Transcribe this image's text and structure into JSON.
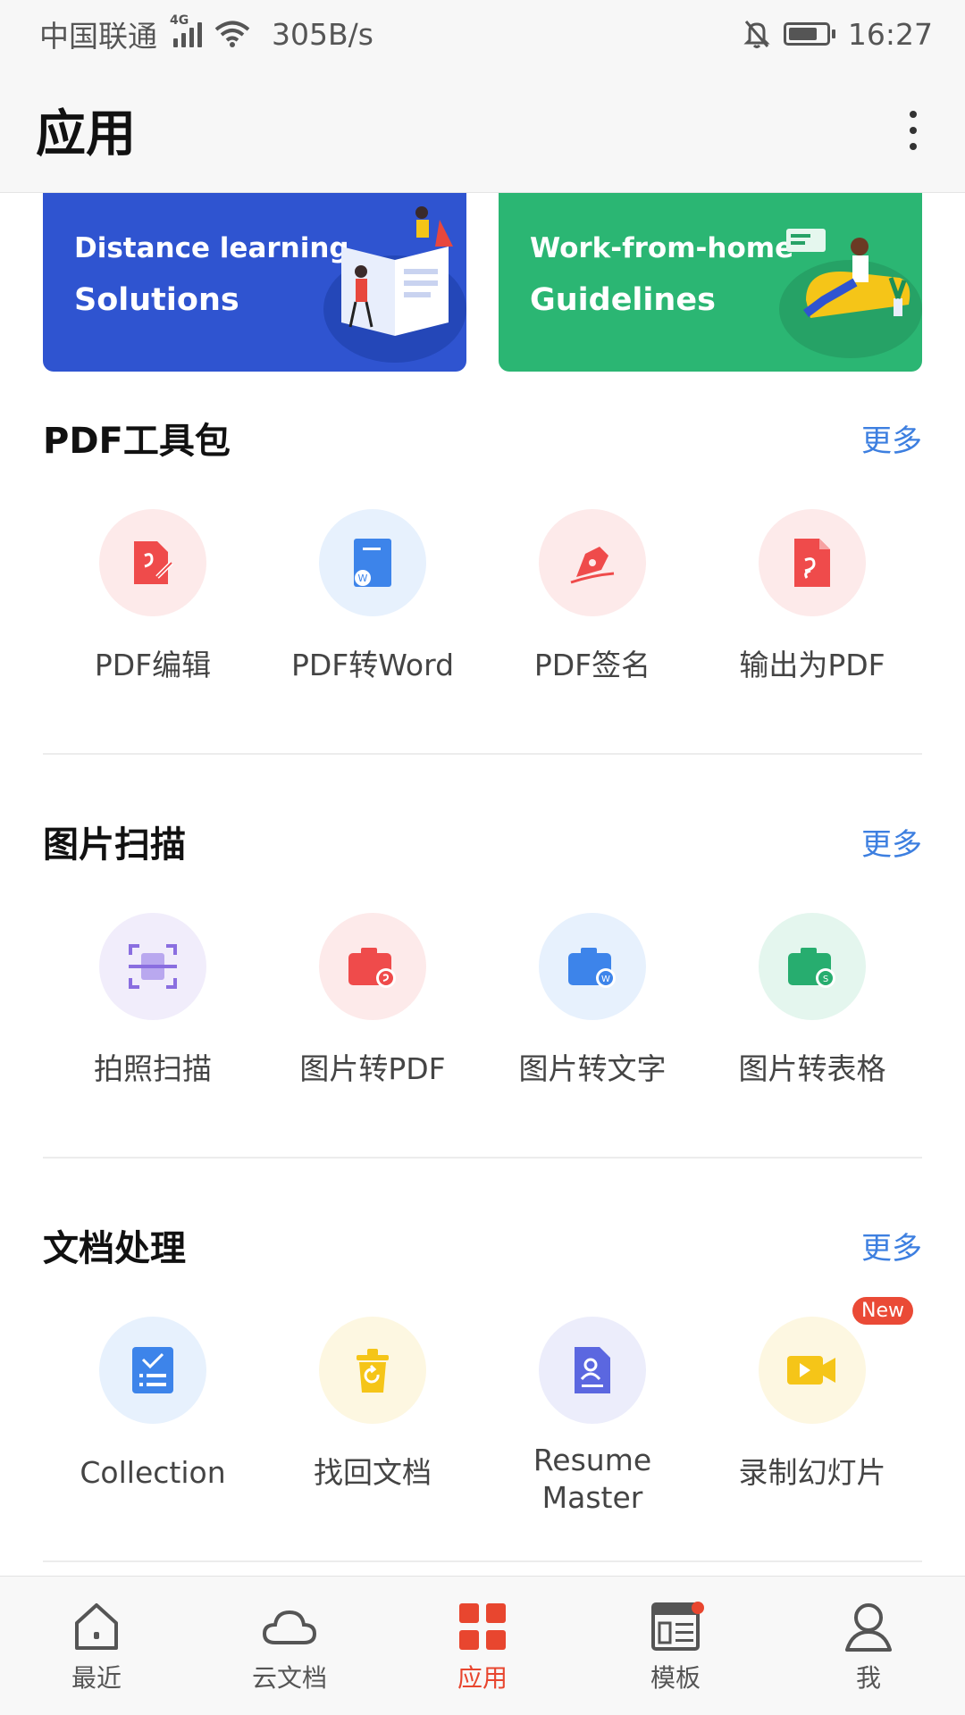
{
  "status_bar": {
    "carrier": "中国联通",
    "network_type": "4G",
    "speed": "305B/s",
    "time": "16:27",
    "icons": [
      "signal-icon",
      "wifi-icon",
      "bell-off-icon",
      "battery-icon"
    ]
  },
  "header": {
    "title": "应用",
    "menu_icon": "more-vertical-icon"
  },
  "banners": [
    {
      "line1": "Distance learning",
      "line2": "Solutions",
      "color": "#2f54d0"
    },
    {
      "line1": "Work-from-home",
      "line2": "Guidelines",
      "color": "#2bb673"
    }
  ],
  "sections": [
    {
      "title": "PDF工具包",
      "more": "更多",
      "tools": [
        {
          "label": "PDF编辑",
          "icon": "pdf-edit-icon",
          "bg": "#fdeaea",
          "color": "#ef4b4b"
        },
        {
          "label": "PDF转Word",
          "icon": "pdf-to-word-icon",
          "bg": "#e7f1fd",
          "color": "#3d84ea"
        },
        {
          "label": "PDF签名",
          "icon": "pen-nib-icon",
          "bg": "#fdeaea",
          "color": "#ef4b4b"
        },
        {
          "label": "输出为PDF",
          "icon": "export-pdf-icon",
          "bg": "#fdeaea",
          "color": "#ef4b4b"
        }
      ]
    },
    {
      "title": "图片扫描",
      "more": "更多",
      "tools": [
        {
          "label": "拍照扫描",
          "icon": "scan-icon",
          "bg": "#f1edfb",
          "color": "#8a6ee0"
        },
        {
          "label": "图片转PDF",
          "icon": "camera-pdf-icon",
          "bg": "#fdeaea",
          "color": "#ef4b4b"
        },
        {
          "label": "图片转文字",
          "icon": "camera-word-icon",
          "bg": "#e7f1fd",
          "color": "#3d84ea"
        },
        {
          "label": "图片转表格",
          "icon": "camera-sheet-icon",
          "bg": "#e4f6ee",
          "color": "#27ad6f"
        }
      ]
    },
    {
      "title": "文档处理",
      "more": "更多",
      "tools": [
        {
          "label": "Collection",
          "icon": "checklist-icon",
          "bg": "#e7f1fd",
          "color": "#3d84ea"
        },
        {
          "label": "找回文档",
          "icon": "recover-trash-icon",
          "bg": "#fdf7e1",
          "color": "#f5c518"
        },
        {
          "label": "Resume Master",
          "icon": "resume-icon",
          "bg": "#ecedfb",
          "color": "#5b67e0"
        },
        {
          "label": "录制幻灯片",
          "icon": "video-record-icon",
          "bg": "#fdf7e1",
          "color": "#f5c518",
          "badge": "New"
        }
      ]
    }
  ],
  "bottom_nav": [
    {
      "label": "最近",
      "icon": "home-icon",
      "active": false
    },
    {
      "label": "云文档",
      "icon": "cloud-icon",
      "active": false
    },
    {
      "label": "应用",
      "icon": "apps-grid-icon",
      "active": true
    },
    {
      "label": "模板",
      "icon": "template-icon",
      "active": false,
      "dot": true
    },
    {
      "label": "我",
      "icon": "user-icon",
      "active": false
    }
  ],
  "accent_color": "#e8462f",
  "link_color": "#3d7fe0"
}
